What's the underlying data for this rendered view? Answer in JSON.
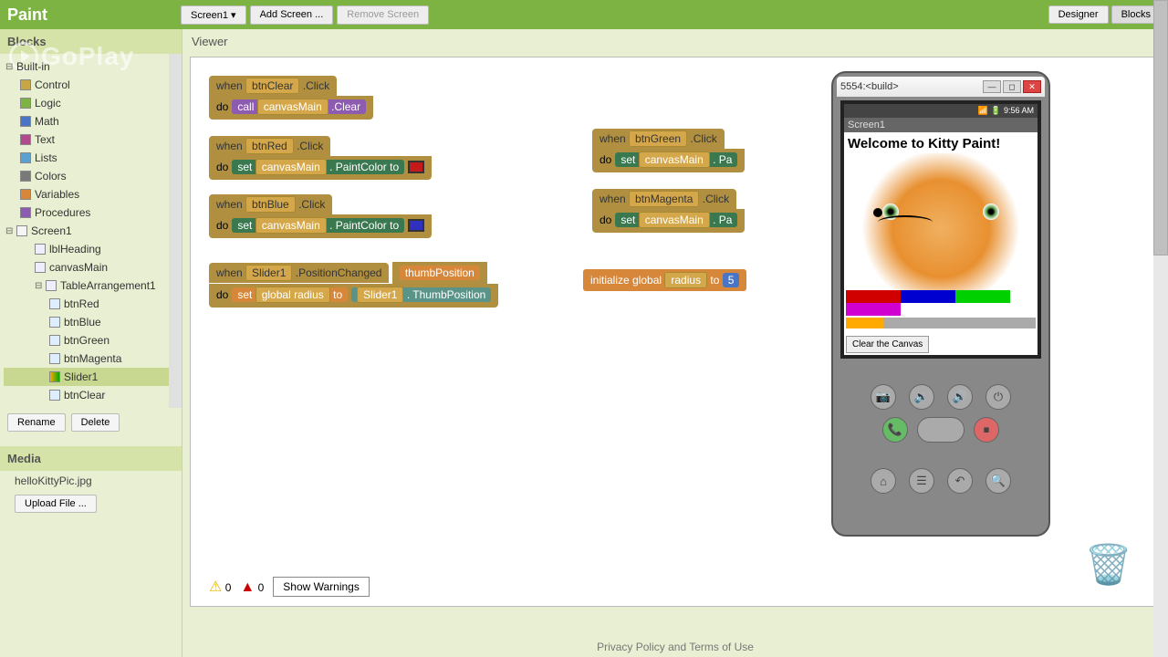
{
  "app": {
    "title": "Paint"
  },
  "toolbar": {
    "screen_btn": "Screen1",
    "add_screen": "Add Screen ...",
    "remove_screen": "Remove Screen",
    "designer": "Designer",
    "blocks": "Blocks"
  },
  "sidebar": {
    "blocks_label": "Blocks",
    "watermark": "GoPlay",
    "builtin": {
      "label": "Built-in",
      "items": [
        {
          "label": "Control",
          "color": "#c9a645"
        },
        {
          "label": "Logic",
          "color": "#7cb342"
        },
        {
          "label": "Math",
          "color": "#4a75c4"
        },
        {
          "label": "Text",
          "color": "#b24b8e"
        },
        {
          "label": "Lists",
          "color": "#5aa0d0"
        },
        {
          "label": "Colors",
          "color": "#7a7a7a"
        },
        {
          "label": "Variables",
          "color": "#d6873a"
        },
        {
          "label": "Procedures",
          "color": "#8d5bb0"
        }
      ]
    },
    "screen": {
      "label": "Screen1",
      "items": [
        {
          "label": "lblHeading",
          "indent": 2
        },
        {
          "label": "canvasMain",
          "indent": 2
        },
        {
          "label": "TableArrangement1",
          "indent": 2,
          "expandable": true
        },
        {
          "label": "btnRed",
          "indent": 3
        },
        {
          "label": "btnBlue",
          "indent": 3
        },
        {
          "label": "btnGreen",
          "indent": 3
        },
        {
          "label": "btnMagenta",
          "indent": 3
        },
        {
          "label": "Slider1",
          "indent": 3,
          "selected": true
        },
        {
          "label": "btnClear",
          "indent": 3
        }
      ]
    },
    "rename": "Rename",
    "delete": "Delete",
    "media_label": "Media",
    "media_items": [
      "helloKittyPic.jpg"
    ],
    "upload": "Upload File ..."
  },
  "viewer": {
    "label": "Viewer"
  },
  "blocks": {
    "b1": {
      "when": "when",
      "comp": "btnClear",
      "event": ".Click",
      "do": "do",
      "call": "call",
      "target": "canvasMain",
      "method": ".Clear"
    },
    "b2": {
      "when": "when",
      "comp": "btnRed",
      "event": ".Click",
      "do": "do",
      "set": "set",
      "target": "canvasMain",
      "prop": ". PaintColor",
      "to": "to",
      "color": "#c41a1a"
    },
    "b3": {
      "when": "when",
      "comp": "btnBlue",
      "event": ".Click",
      "do": "do",
      "set": "set",
      "target": "canvasMain",
      "prop": ". PaintColor",
      "to": "to",
      "color": "#3030c0"
    },
    "b4": {
      "when": "when",
      "comp": "btnGreen",
      "event": ".Click",
      "do": "do",
      "set": "set",
      "target": "canvasMain",
      "prop": ". Pa"
    },
    "b5": {
      "when": "when",
      "comp": "btnMagenta",
      "event": ".Click",
      "do": "do",
      "set": "set",
      "target": "canvasMain",
      "prop": ". Pa"
    },
    "b6": {
      "when": "when",
      "comp": "Slider1",
      "event": ".PositionChanged",
      "param": "thumbPosition",
      "do": "do",
      "set": "set",
      "var": "global radius",
      "to": "to",
      "src_comp": "Slider1",
      "src_prop": ". ThumbPosition"
    },
    "b7": {
      "init": "initialize global",
      "name": "radius",
      "to": "to",
      "val": "5"
    }
  },
  "emulator": {
    "title": "5554:<build>",
    "time": "9:56 AM",
    "screen_title": "Screen1",
    "welcome": "Welcome to Kitty Paint!",
    "colors": [
      {
        "c": "#d00000"
      },
      {
        "c": "#0000d0"
      },
      {
        "c": "#00d000"
      },
      {
        "c": "#d000d0"
      }
    ],
    "clear_btn": "Clear the Canvas"
  },
  "warnings": {
    "warn_count": "0",
    "err_count": "0",
    "show": "Show Warnings"
  },
  "footer": "Privacy Policy and Terms of Use"
}
